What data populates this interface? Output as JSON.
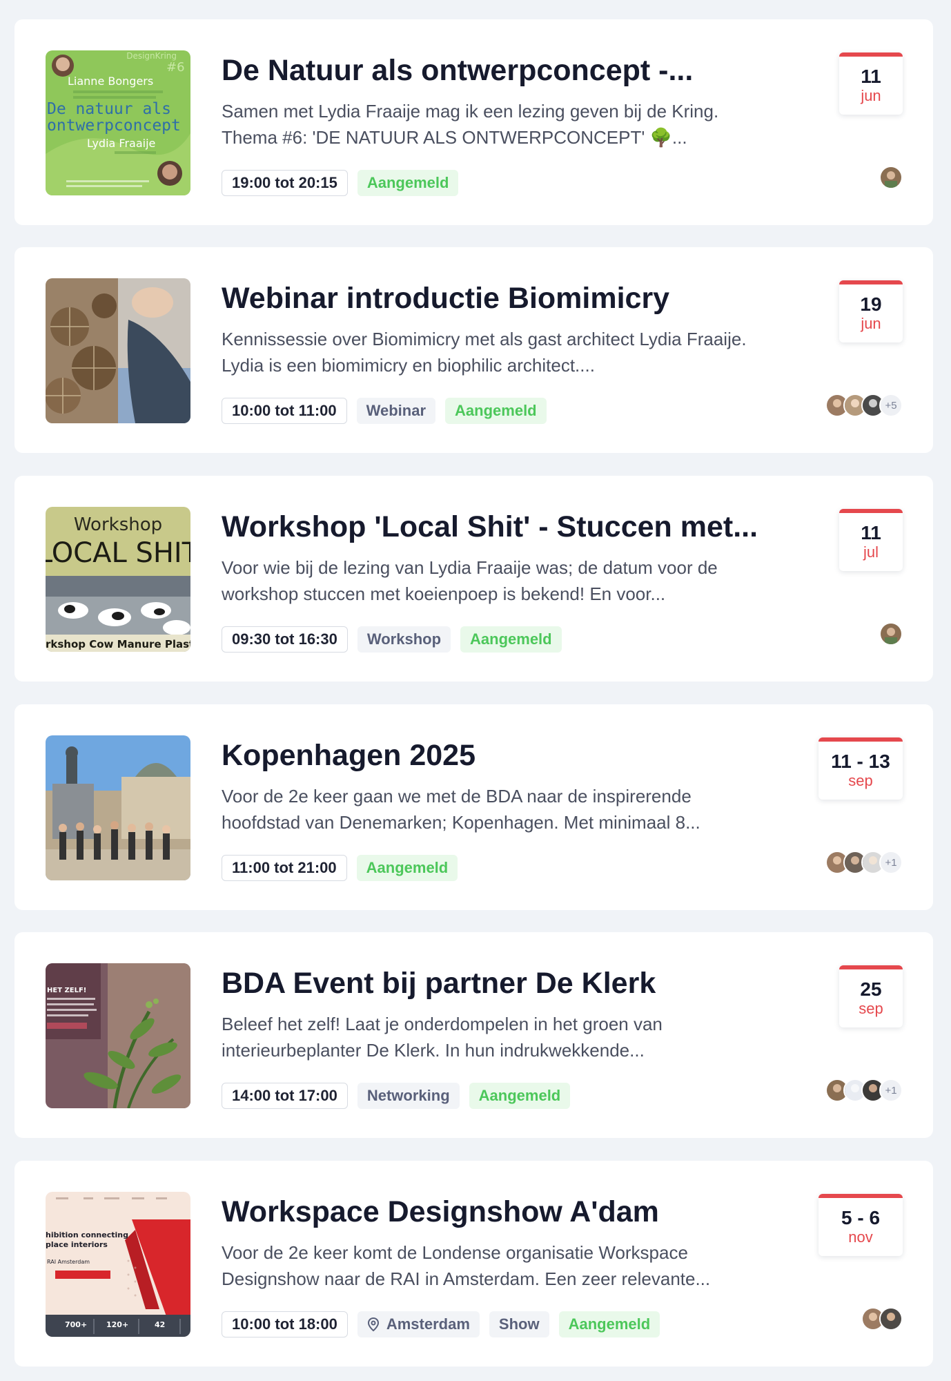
{
  "events": [
    {
      "title": "De Natuur als ontwerpconcept -...",
      "description": "Samen met Lydia Fraaije mag ik een lezing geven bij de Kring. Thema #6: 'DE NATUUR ALS ONTWERPCONCEPT' 🌳...",
      "time": "19:00 tot 20:15",
      "category": "",
      "location": "",
      "status": "Aangemeld",
      "date_day": "11",
      "date_month": "jun",
      "extra_attendees": "",
      "image": {
        "kind": "poster",
        "texts": [
          "DesignKring",
          "#6",
          "Lianne Bongers",
          "De natuur als",
          "ontwerpconcept",
          "Lydia Fraaije"
        ]
      }
    },
    {
      "title": "Webinar introductie Biomimicry",
      "description": "Kennissessie over Biomimicry met als gast architect Lydia Fraaije. Lydia is een biomimicry en biophilic architect....",
      "time": "10:00 tot 11:00",
      "category": "Webinar",
      "location": "",
      "status": "Aangemeld",
      "date_day": "19",
      "date_month": "jun",
      "extra_attendees": "+5",
      "image": {
        "kind": "burdock"
      }
    },
    {
      "title": "Workshop 'Local Shit' - Stuccen met...",
      "description": "Voor wie bij de lezing van Lydia Fraaije was; de datum voor de workshop stuccen met koeienpoep is bekend! En voor...",
      "time": "09:30 tot 16:30",
      "category": "Workshop",
      "location": "",
      "status": "Aangemeld",
      "date_day": "11",
      "date_month": "jul",
      "extra_attendees": "",
      "image": {
        "kind": "workshop",
        "texts": [
          "Workshop",
          "LOCAL SHIT",
          "rkshop Cow Manure Plaste"
        ]
      }
    },
    {
      "title": "Kopenhagen 2025",
      "description": "Voor de 2e keer gaan we met de BDA naar de inspirerende hoofdstad van Denemarken; Kopenhagen. Met minimaal 8...",
      "time": "11:00 tot 21:00",
      "category": "",
      "location": "",
      "status": "Aangemeld",
      "date_day": "11 - 13",
      "date_month": "sep",
      "extra_attendees": "+1",
      "image": {
        "kind": "square"
      }
    },
    {
      "title": "BDA Event bij partner De Klerk",
      "description": "Beleef het zelf! Laat je onderdompelen in het groen van interieurbeplanter De Klerk. In hun indrukwekkende...",
      "time": "14:00 tot 17:00",
      "category": "Networking",
      "location": "",
      "status": "Aangemeld",
      "date_day": "25",
      "date_month": "sep",
      "extra_attendees": "+1",
      "image": {
        "kind": "plant",
        "texts": [
          "HET ZELF!"
        ]
      }
    },
    {
      "title": "Workspace Designshow A'dam",
      "description": "Voor de 2e keer komt de Londense organisatie Workspace Designshow naar de RAI in Amsterdam. Een zeer relevante...",
      "time": "10:00 tot 18:00",
      "category": "Show",
      "location": "Amsterdam",
      "status": "Aangemeld",
      "date_day": "5 - 6",
      "date_month": "nov",
      "extra_attendees": "",
      "image": {
        "kind": "expo",
        "texts": [
          "hibition connecting",
          "place interiors",
          "RAI Amsterdam",
          "700+",
          "120+",
          "42"
        ]
      }
    }
  ],
  "colors": {
    "accent_red": "#e5484d",
    "status_green": "#4cc75a",
    "page_bg": "#f0f3f7"
  },
  "icons": {
    "location": "map-pin-icon"
  }
}
